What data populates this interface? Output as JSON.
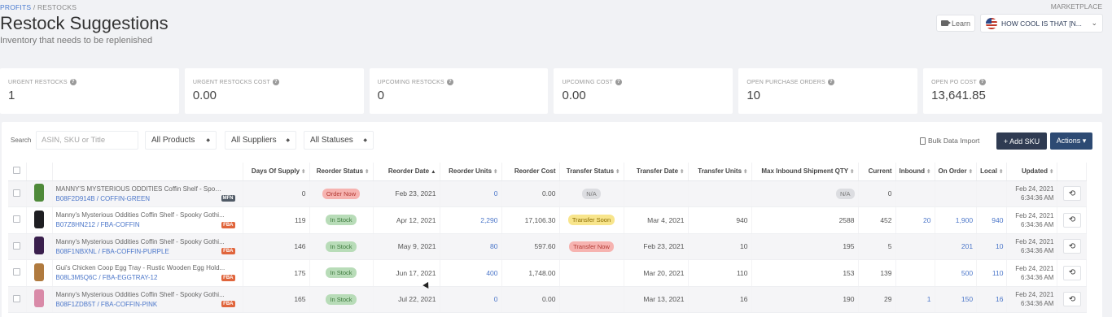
{
  "breadcrumb": {
    "root": "PROFITS",
    "sep": "/",
    "current": "RESTOCKS"
  },
  "marketplace_label": "MARKETPLACE",
  "page": {
    "title": "Restock Suggestions",
    "subtitle": "Inventory that needs to be replenished"
  },
  "header": {
    "learn_label": "Learn",
    "marketplace_value": "HOW COOL IS THAT [N...",
    "chevron": "⌄"
  },
  "stats": [
    {
      "label": "URGENT RESTOCKS",
      "value": "1"
    },
    {
      "label": "URGENT RESTOCKS COST",
      "value": "0.00"
    },
    {
      "label": "UPCOMING RESTOCKS",
      "value": "0"
    },
    {
      "label": "UPCOMING COST",
      "value": "0.00"
    },
    {
      "label": "OPEN PURCHASE ORDERS",
      "value": "10"
    },
    {
      "label": "OPEN PO COST",
      "value": "13,641.85"
    }
  ],
  "filters": {
    "search_label": "Search",
    "search_placeholder": "ASIN, SKU or Title",
    "products": "All Products",
    "suppliers": "All Suppliers",
    "statuses": "All Statuses",
    "bulk_import": "Bulk Data Import",
    "add_sku": "+ Add SKU",
    "actions": "Actions ▾"
  },
  "columns": {
    "days_of_supply": "Days Of Supply",
    "reorder_status": "Reorder Status",
    "reorder_date": "Reorder Date",
    "reorder_units": "Reorder Units",
    "reorder_cost": "Reorder Cost",
    "transfer_status": "Transfer Status",
    "transfer_date": "Transfer Date",
    "transfer_units": "Transfer Units",
    "max_inbound": "Max Inbound Shipment QTY",
    "current": "Current",
    "inbound": "Inbound",
    "on_order": "On Order",
    "local": "Local",
    "updated": "Updated"
  },
  "rows": [
    {
      "title": "MANNY'S MYSTERIOUS ODDITIES Coffin Shelf - Spooky...",
      "sku": "B08F2D914B / COFFIN-GREEN",
      "channel": "MFN",
      "thumb_color": "#4f8a3a",
      "days": "0",
      "reorder_status": "Order Now",
      "reorder_status_color": "red",
      "reorder_date": "Feb 23, 2021",
      "reorder_units": "0",
      "reorder_cost": "0.00",
      "transfer_status": "N/A",
      "transfer_status_color": "grey",
      "transfer_date": "",
      "transfer_units": "",
      "max_inbound": "N/A",
      "current": "0",
      "inbound": "",
      "on_order": "",
      "local": "",
      "updated_date": "Feb 24, 2021",
      "updated_time": "6:34:36 AM"
    },
    {
      "title": "Manny's Mysterious Oddities Coffin Shelf - Spooky Gothi...",
      "sku": "B07Z8HN212 / FBA-COFFIN",
      "channel": "FBA",
      "thumb_color": "#1e1e22",
      "days": "119",
      "reorder_status": "In Stock",
      "reorder_status_color": "green",
      "reorder_date": "Apr 12, 2021",
      "reorder_units": "2,290",
      "reorder_cost": "17,106.30",
      "transfer_status": "Transfer Soon",
      "transfer_status_color": "yellow",
      "transfer_date": "Mar 4, 2021",
      "transfer_units": "940",
      "max_inbound": "2588",
      "current": "452",
      "inbound": "20",
      "on_order": "1,900",
      "local": "940",
      "updated_date": "Feb 24, 2021",
      "updated_time": "6:34:36 AM"
    },
    {
      "title": "Manny's Mysterious Oddities Coffin Shelf - Spooky Gothi...",
      "sku": "B08F1NBXNL / FBA-COFFIN-PURPLE",
      "channel": "FBA",
      "thumb_color": "#3a1f4d",
      "days": "146",
      "reorder_status": "In Stock",
      "reorder_status_color": "green",
      "reorder_date": "May 9, 2021",
      "reorder_units": "80",
      "reorder_cost": "597.60",
      "transfer_status": "Transfer Now",
      "transfer_status_color": "red",
      "transfer_date": "Feb 23, 2021",
      "transfer_units": "10",
      "max_inbound": "195",
      "current": "5",
      "inbound": "",
      "on_order": "201",
      "local": "10",
      "updated_date": "Feb 24, 2021",
      "updated_time": "6:34:36 AM"
    },
    {
      "title": "Gui's Chicken Coop Egg Tray - Rustic Wooden Egg Hold...",
      "sku": "B08L3M5Q6C / FBA-EGGTRAY-12",
      "channel": "FBA",
      "thumb_color": "#b07a3e",
      "days": "175",
      "reorder_status": "In Stock",
      "reorder_status_color": "green",
      "reorder_date": "Jun 17, 2021",
      "reorder_units": "400",
      "reorder_cost": "1,748.00",
      "transfer_status": "",
      "transfer_status_color": "",
      "transfer_date": "Mar 20, 2021",
      "transfer_units": "110",
      "max_inbound": "153",
      "current": "139",
      "inbound": "",
      "on_order": "500",
      "local": "110",
      "updated_date": "Feb 24, 2021",
      "updated_time": "6:34:36 AM"
    },
    {
      "title": "Manny's Mysterious Oddities Coffin Shelf - Spooky Gothi...",
      "sku": "B08F1ZDB5T / FBA-COFFIN-PINK",
      "channel": "FBA",
      "thumb_color": "#d98aa8",
      "days": "165",
      "reorder_status": "In Stock",
      "reorder_status_color": "green",
      "reorder_date": "Jul 22, 2021",
      "reorder_units": "0",
      "reorder_cost": "0.00",
      "transfer_status": "",
      "transfer_status_color": "",
      "transfer_date": "Mar 13, 2021",
      "transfer_units": "16",
      "max_inbound": "190",
      "current": "29",
      "inbound": "1",
      "on_order": "150",
      "local": "16",
      "updated_date": "Feb 24, 2021",
      "updated_time": "6:34:36 AM"
    }
  ]
}
